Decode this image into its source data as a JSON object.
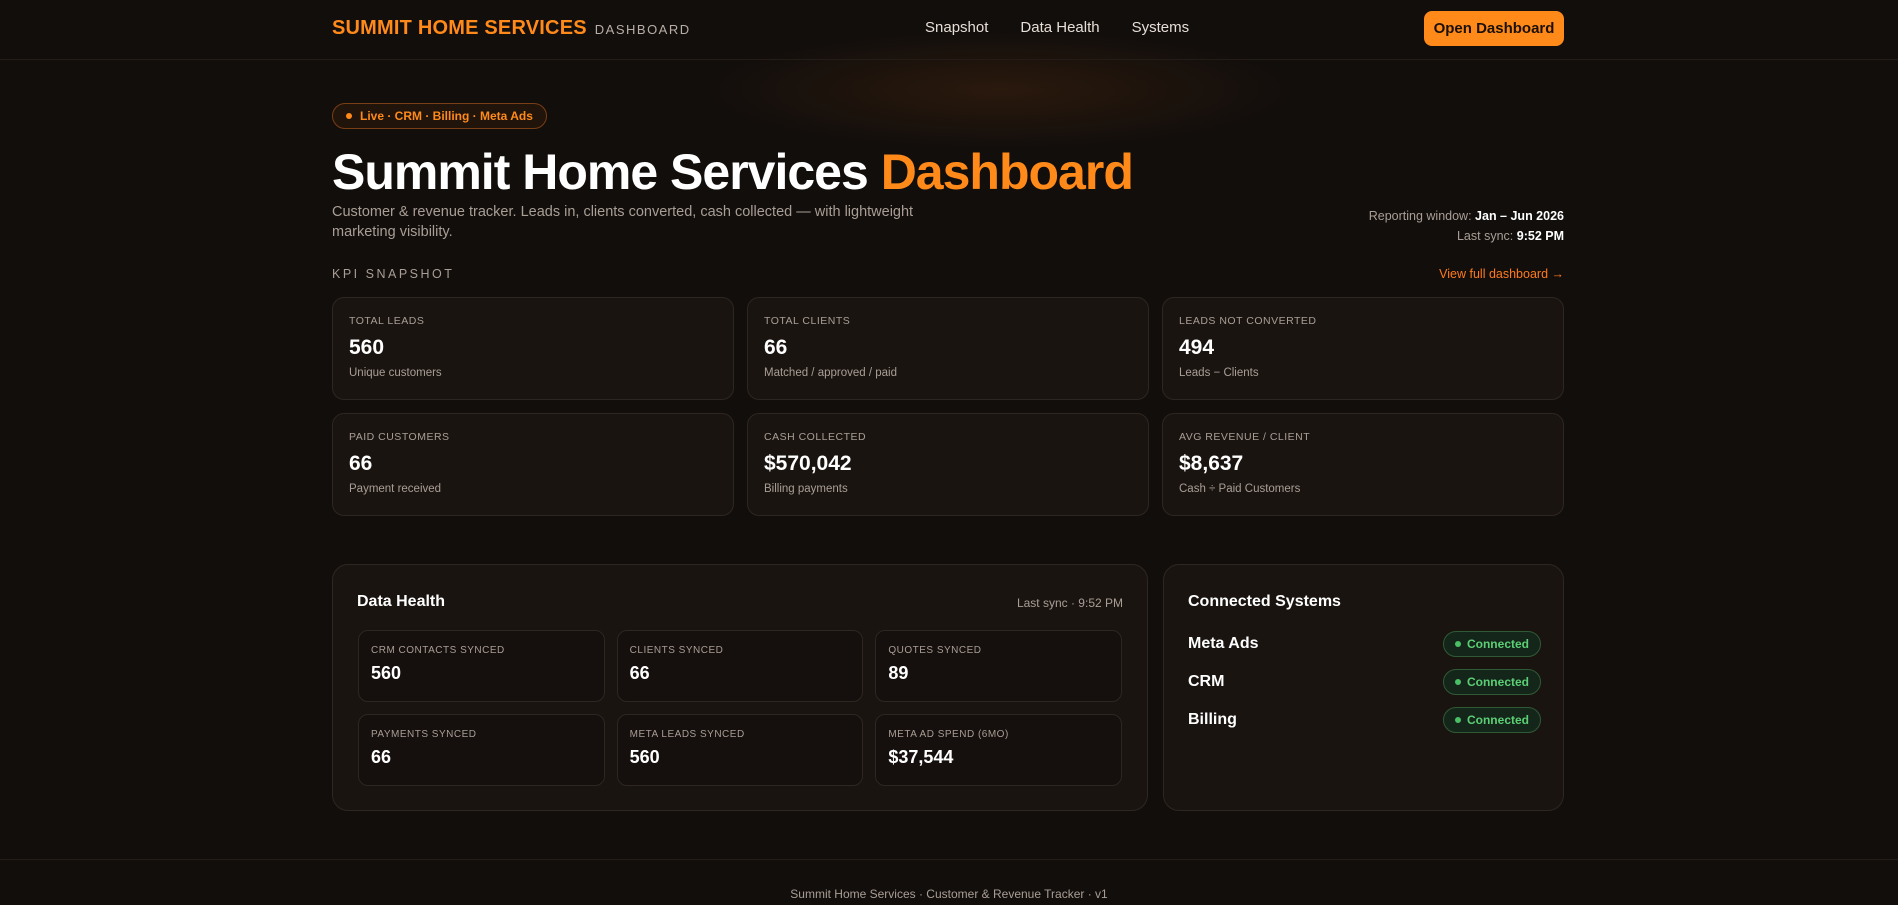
{
  "header": {
    "brand_name": "SUMMIT HOME SERVICES",
    "brand_sub": "DASHBOARD",
    "nav": [
      "Snapshot",
      "Data Health",
      "Systems"
    ],
    "cta_label": "Open Dashboard"
  },
  "hero": {
    "pill": "Live · CRM · Billing · Meta Ads",
    "title_main": "Summit Home Services",
    "title_accent": "Dashboard",
    "description": "Customer & revenue tracker. Leads in, clients converted, cash collected — with lightweight marketing visibility.",
    "reporting_label": "Reporting window:",
    "reporting_value": "Jan – Jun 2026",
    "sync_label": "Last sync:",
    "sync_value": "9:52 PM"
  },
  "kpi": {
    "section_label": "KPI SNAPSHOT",
    "view_link": "View full dashboard →",
    "cards": [
      {
        "label": "TOTAL LEADS",
        "value": "560",
        "sub": "Unique customers"
      },
      {
        "label": "TOTAL CLIENTS",
        "value": "66",
        "sub": "Matched / approved / paid"
      },
      {
        "label": "LEADS NOT CONVERTED",
        "value": "494",
        "sub": "Leads − Clients"
      },
      {
        "label": "PAID CUSTOMERS",
        "value": "66",
        "sub": "Payment received"
      },
      {
        "label": "CASH COLLECTED",
        "value": "$570,042",
        "sub": "Billing payments"
      },
      {
        "label": "AVG REVENUE / CLIENT",
        "value": "$8,637",
        "sub": "Cash ÷ Paid Customers"
      }
    ]
  },
  "health": {
    "title": "Data Health",
    "last_sync": "Last sync · 9:52 PM",
    "cards": [
      {
        "label": "CRM CONTACTS SYNCED",
        "value": "560"
      },
      {
        "label": "CLIENTS SYNCED",
        "value": "66"
      },
      {
        "label": "QUOTES SYNCED",
        "value": "89"
      },
      {
        "label": "PAYMENTS SYNCED",
        "value": "66"
      },
      {
        "label": "META LEADS SYNCED",
        "value": "560"
      },
      {
        "label": "META AD SPEND (6MO)",
        "value": "$37,544"
      }
    ]
  },
  "systems": {
    "title": "Connected Systems",
    "items": [
      {
        "name": "Meta Ads",
        "status": "Connected"
      },
      {
        "name": "CRM",
        "status": "Connected"
      },
      {
        "name": "Billing",
        "status": "Connected"
      }
    ]
  },
  "footer": {
    "text": "Summit Home Services · Customer & Revenue Tracker · v1"
  },
  "colors": {
    "accent": "#ff8a1a",
    "background": "#120e0c",
    "card": "#1a1411",
    "connected": "#5ccf74"
  }
}
